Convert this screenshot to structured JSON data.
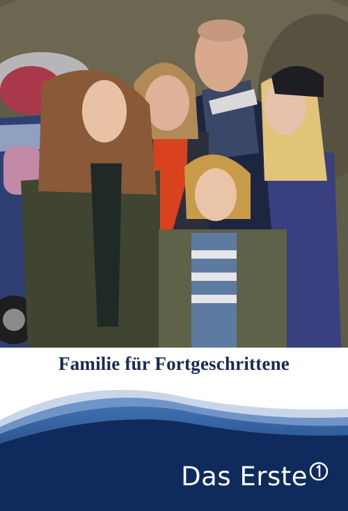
{
  "poster": {
    "title": "Familie für Fortgeschrittene",
    "channel": "Das Erste",
    "channel_logo_icon": "ard-one-icon"
  },
  "colors": {
    "title_text": "#1a2a55",
    "band_dark": "#0f2a5c",
    "band_light": "#3f6fb0",
    "brand_text": "#ffffff"
  }
}
